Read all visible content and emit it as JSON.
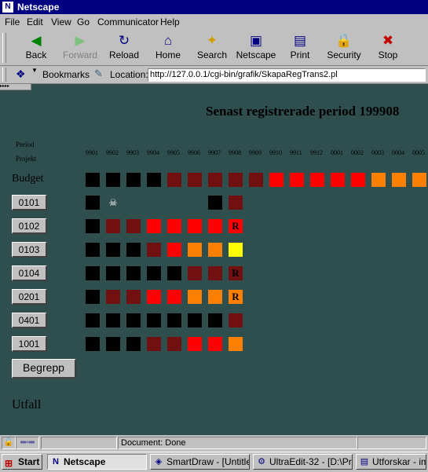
{
  "window": {
    "title": "Netscape"
  },
  "menu": [
    "File",
    "Edit",
    "View",
    "Go",
    "Communicator",
    "Help"
  ],
  "toolbar": [
    {
      "label": "Back",
      "icon": "back-arrow-icon",
      "glyph": "◀",
      "color": "#008000",
      "enabled": true
    },
    {
      "label": "Forward",
      "icon": "forward-arrow-icon",
      "glyph": "▶",
      "color": "#80c080",
      "enabled": false
    },
    {
      "label": "Reload",
      "icon": "reload-icon",
      "glyph": "↻",
      "color": "#000080",
      "enabled": true
    },
    {
      "label": "Home",
      "icon": "home-icon",
      "glyph": "⌂",
      "color": "#000080",
      "enabled": true
    },
    {
      "label": "Search",
      "icon": "search-icon",
      "glyph": "✦",
      "color": "#d0a000",
      "enabled": true
    },
    {
      "label": "Netscape",
      "icon": "netscape-icon",
      "glyph": "▣",
      "color": "#000080",
      "enabled": true
    },
    {
      "label": "Print",
      "icon": "print-icon",
      "glyph": "▤",
      "color": "#000080",
      "enabled": true
    },
    {
      "label": "Security",
      "icon": "lock-icon",
      "glyph": "🔒",
      "color": "#c00000",
      "enabled": true
    },
    {
      "label": "Stop",
      "icon": "stop-icon",
      "glyph": "✖",
      "color": "#c00000",
      "enabled": true
    }
  ],
  "location": {
    "bookmarks_label": "Bookmarks",
    "location_label": "Location:",
    "url": "http://127.0.0.1/cgi-bin/grafik/SkapaRegTrans2.pl"
  },
  "page": {
    "heading": "Senast registrerade period 199908",
    "period_label": "Period",
    "projekt_label": "Projekt",
    "budget_label": "Budget",
    "utfall_label": "Utfall",
    "begrepp_button": "Begrepp",
    "columns": [
      "9901",
      "9902",
      "9903",
      "9904",
      "9905",
      "9906",
      "9907",
      "9908",
      "9909",
      "9910",
      "9911",
      "9912",
      "0001",
      "0002",
      "0003",
      "0004",
      "0005"
    ],
    "budget_row": [
      "#000000",
      "#000000",
      "#000000",
      "#000000",
      "#701010",
      "#701010",
      "#701010",
      "#701010",
      "#701010",
      "#ff0000",
      "#ff0000",
      "#ff0000",
      "#ff0000",
      "#ff0000",
      "#ff8000",
      "#ff8000",
      "#ff8000"
    ],
    "projects": [
      {
        "name": "0101",
        "cells": [
          {
            "color": "#000000"
          },
          {
            "color": "",
            "mark": "☠"
          },
          {
            "color": ""
          },
          {
            "color": ""
          },
          {
            "color": ""
          },
          {
            "color": ""
          },
          {
            "color": "#000000"
          },
          {
            "color": "#701010"
          }
        ]
      },
      {
        "name": "0102",
        "cells": [
          {
            "color": "#000000"
          },
          {
            "color": "#701010"
          },
          {
            "color": "#701010"
          },
          {
            "color": "#ff0000"
          },
          {
            "color": "#ff0000"
          },
          {
            "color": "#ff0000"
          },
          {
            "color": "#ff0000"
          },
          {
            "color": "#ff0000",
            "mark": "R"
          }
        ]
      },
      {
        "name": "0103",
        "cells": [
          {
            "color": "#000000"
          },
          {
            "color": "#000000"
          },
          {
            "color": "#000000"
          },
          {
            "color": "#701010"
          },
          {
            "color": "#ff0000"
          },
          {
            "color": "#ff8000"
          },
          {
            "color": "#ff8000"
          },
          {
            "color": "#ffff00"
          }
        ]
      },
      {
        "name": "0104",
        "cells": [
          {
            "color": "#000000"
          },
          {
            "color": "#000000"
          },
          {
            "color": "#000000"
          },
          {
            "color": "#000000"
          },
          {
            "color": "#000000"
          },
          {
            "color": "#701010"
          },
          {
            "color": "#701010"
          },
          {
            "color": "#701010",
            "mark": "R"
          }
        ]
      },
      {
        "name": "0201",
        "cells": [
          {
            "color": "#000000"
          },
          {
            "color": "#701010"
          },
          {
            "color": "#701010"
          },
          {
            "color": "#ff0000"
          },
          {
            "color": "#ff0000"
          },
          {
            "color": "#ff8000"
          },
          {
            "color": "#ff8000"
          },
          {
            "color": "#ff8000",
            "mark": "R"
          }
        ]
      },
      {
        "name": "0401",
        "cells": [
          {
            "color": "#000000"
          },
          {
            "color": "#000000"
          },
          {
            "color": "#000000"
          },
          {
            "color": "#000000"
          },
          {
            "color": "#000000"
          },
          {
            "color": "#000000"
          },
          {
            "color": "#000000"
          },
          {
            "color": "#701010"
          }
        ]
      },
      {
        "name": "1001",
        "cells": [
          {
            "color": "#000000"
          },
          {
            "color": "#000000"
          },
          {
            "color": "#000000"
          },
          {
            "color": "#701010"
          },
          {
            "color": "#701010"
          },
          {
            "color": "#ff0000"
          },
          {
            "color": "#ff0000"
          },
          {
            "color": "#ff8000"
          }
        ]
      }
    ]
  },
  "status": {
    "text": "Document: Done"
  },
  "taskbar": {
    "start_label": "Start",
    "tasks": [
      {
        "label": "Netscape",
        "icon": "netscape-task-icon",
        "active": true
      },
      {
        "label": "SmartDraw - [Untitle...",
        "icon": "smartdraw-icon",
        "active": false
      },
      {
        "label": "UltraEdit-32 - [D:\\Pr...",
        "icon": "ultraedit-icon",
        "active": false
      },
      {
        "label": "Utforskar - ima",
        "icon": "explorer-icon",
        "active": false
      }
    ]
  }
}
